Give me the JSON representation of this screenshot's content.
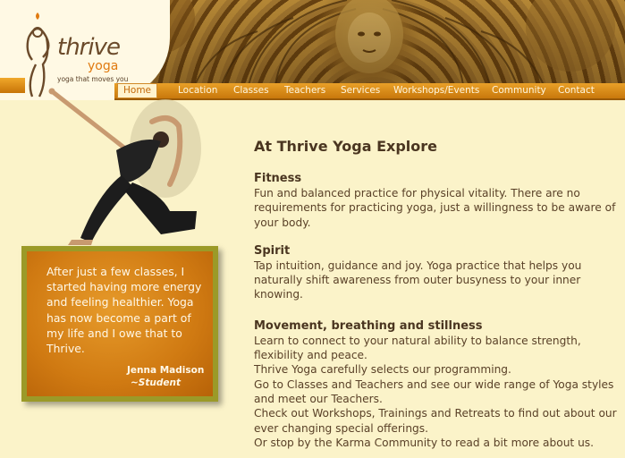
{
  "logo": {
    "name_primary": "thrive",
    "name_secondary": "yoga",
    "tagline": "yoga that moves you",
    "accent_color": "#e07a10"
  },
  "nav": {
    "items": [
      {
        "label": "Home",
        "active": true
      },
      {
        "label": "Location"
      },
      {
        "label": "Classes"
      },
      {
        "label": "Teachers"
      },
      {
        "label": "Services"
      },
      {
        "label": "Workshops/Events"
      },
      {
        "label": "Community"
      },
      {
        "label": "Contact"
      }
    ],
    "bar_color": "#d8880f"
  },
  "testimonial": {
    "quote": "After just a few classes, I started having more energy and feeling healthier. Yoga has now become a part of my life and I owe that to Thrive.",
    "name": "Jenna Madison",
    "role": "~Student"
  },
  "main": {
    "title": "At Thrive Yoga Explore",
    "sections": [
      {
        "heading": "Fitness",
        "body": "Fun and balanced practice for physical vitality. There are no requirements for practicing yoga, just a willingness to be aware of your body."
      },
      {
        "heading": "Spirit",
        "body": "Tap intuition, guidance and joy. Yoga practice that helps you naturally shift awareness from outer busyness to your inner knowing."
      },
      {
        "heading": "Movement, breathing and stillness",
        "paragraphs": [
          "Learn to connect to your natural ability to balance strength, flexibility and peace.",
          "Thrive Yoga carefully selects our programming.",
          "Go to Classes and Teachers and see our wide range of Yoga styles and meet our Teachers.",
          "Check out Workshops, Trainings and Retreats to find out about our ever changing special offerings.",
          "Or stop by the Karma Community to read a bit more about us."
        ]
      }
    ]
  },
  "colors": {
    "background": "#fbf3c9",
    "text": "#5a4128",
    "quote_box": "#d07a12",
    "quote_border": "#9b9a28"
  }
}
